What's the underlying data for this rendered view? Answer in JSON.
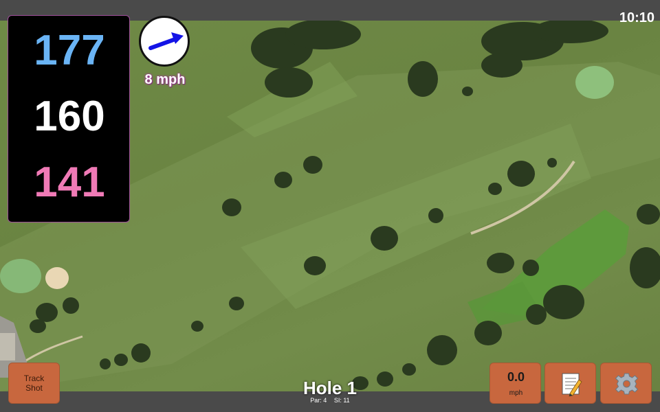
{
  "status": {
    "time": "10:10"
  },
  "distances": {
    "back": "177",
    "center": "160",
    "front": "141"
  },
  "wind": {
    "speed": "8 mph"
  },
  "controls": {
    "track_shot_line1": "Track",
    "track_shot_line2": "Shot",
    "speed_value": "0.0",
    "speed_unit": "mph",
    "notes_icon": "notepad-icon",
    "settings_icon": "gear-icon"
  },
  "hole": {
    "title": "Hole 1",
    "par": "Par: 4",
    "si": "SI: 11"
  },
  "colors": {
    "back": "#6ab4f5",
    "center": "#ffffff",
    "front": "#f07ab6",
    "button": "#c8673e"
  }
}
